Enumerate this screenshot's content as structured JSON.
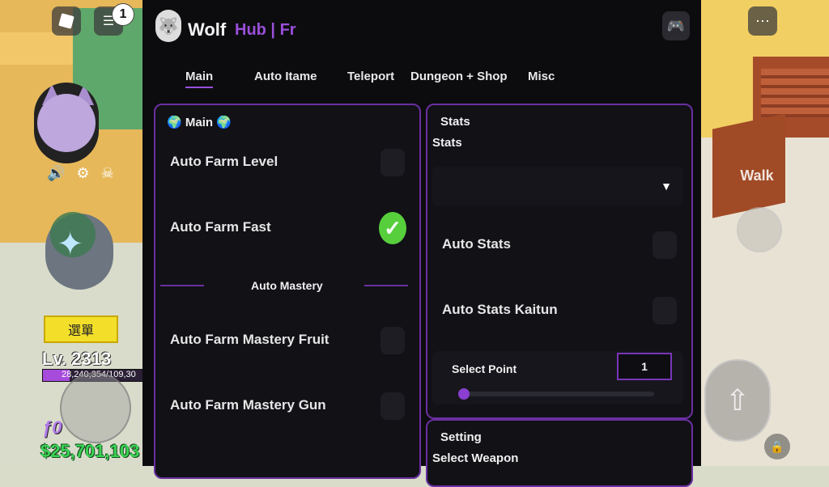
{
  "hud": {
    "notification_count": "1",
    "menu_button": "選單",
    "level": "Lv. 2313",
    "xp_text": "28,240,354/109,30",
    "xp_fraction": 0.26,
    "fragments": "ƒ0",
    "money": "$25,701,103",
    "walk_label": "Walk"
  },
  "window": {
    "title": "Wolf",
    "subtitle": "Hub | Fr",
    "tabs": [
      {
        "label": "Main",
        "active": true
      },
      {
        "label": "Auto Itame",
        "active": false
      },
      {
        "label": "Teleport",
        "active": false
      },
      {
        "label": "Dungeon + Shop",
        "active": false
      },
      {
        "label": "Misc",
        "active": false
      }
    ]
  },
  "left_panel": {
    "title": "Main",
    "rows": [
      {
        "label": "Auto Farm Level",
        "enabled": false
      },
      {
        "label": "Auto Farm Fast",
        "enabled": true
      }
    ],
    "section_label": "Auto Mastery",
    "mastery_rows": [
      {
        "label": "Auto Farm Mastery Fruit",
        "enabled": false
      },
      {
        "label": "Auto Farm Mastery Gun",
        "enabled": false
      }
    ]
  },
  "right_panel": {
    "title": "Stats",
    "dropdown_label": "Stats",
    "rows": [
      {
        "label": "Auto Stats",
        "enabled": false
      },
      {
        "label": "Auto Stats Kaitun",
        "enabled": false
      }
    ],
    "select_point_label": "Select Point",
    "select_point_value": "1"
  },
  "right_panel_2": {
    "title": "Setting",
    "select_label": "Select Weapon"
  },
  "colors": {
    "accent": "#9a4fd9",
    "panel_border": "#6a2fa0",
    "toggle_on": "#57cf3c",
    "money": "#39d354"
  }
}
